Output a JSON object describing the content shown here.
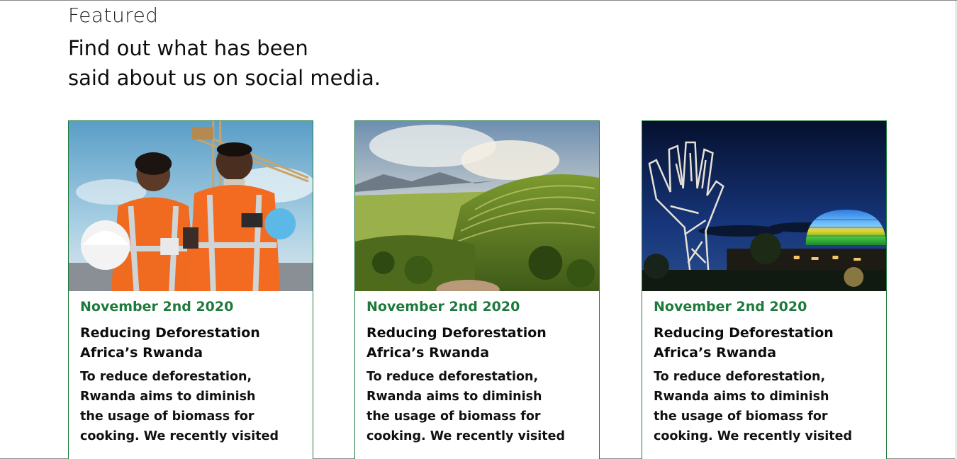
{
  "section": {
    "eyebrow": "Featured",
    "headline_line1": "Find out what has been",
    "headline_line2": "said about us on social media."
  },
  "cards": [
    {
      "image": "workers-in-safety-vests-photo",
      "date": "November 2nd 2020",
      "title_line1": "Reducing Deforestation",
      "title_line2": "Africa’s Rwanda",
      "excerpt_lines": [
        "To reduce deforestation,",
        "Rwanda aims to diminish",
        "the usage of biomass for",
        "cooking. We recently visited"
      ]
    },
    {
      "image": "rwanda-green-hills-landscape-photo",
      "date": "November 2nd 2020",
      "title_line1": "Reducing Deforestation",
      "title_line2": "Africa’s Rwanda",
      "excerpt_lines": [
        "To reduce deforestation,",
        "Rwanda aims to diminish",
        "the usage of biomass for",
        "cooking. We recently visited"
      ]
    },
    {
      "image": "kigali-hand-sculpture-and-convention-dome-night-photo",
      "date": "November 2nd 2020",
      "title_line1": "Reducing Deforestation",
      "title_line2": "Africa’s Rwanda",
      "excerpt_lines": [
        "To reduce deforestation,",
        "Rwanda aims to diminish",
        "the usage of biomass for",
        "cooking. We recently visited"
      ]
    }
  ],
  "colors": {
    "accent_green": "#1e7a3c",
    "text": "#0d0d0d"
  }
}
